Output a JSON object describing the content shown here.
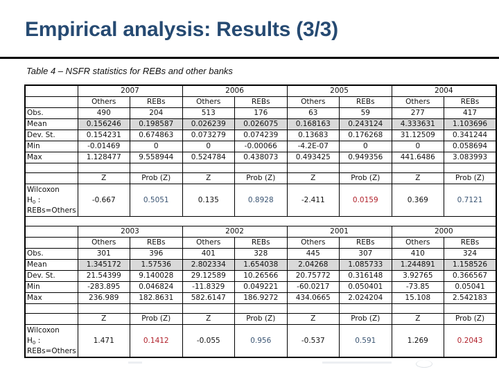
{
  "slide": {
    "title": "Empirical analysis: Results (3/3)",
    "caption": "Table 4 – NSFR statistics for REBs and other banks"
  },
  "table": {
    "group_labels": [
      "Others",
      "REBs"
    ],
    "row_labels": {
      "obs": "Obs.",
      "mean": "Mean",
      "dev": "Dev. St.",
      "min": "Min",
      "max": "Max",
      "z": "Z",
      "prob": "Prob (Z)",
      "wilcoxon_line1": "Wilcoxon",
      "wilcoxon_h": "H",
      "wilcoxon_sub": "0",
      "wilcoxon_colon": " :",
      "wilcoxon_line3": "REBs=Others"
    },
    "panels": [
      {
        "years": [
          {
            "year": "2007",
            "others": {
              "obs": "490",
              "mean": "0.156246",
              "dev": "0.154231",
              "min": "-0.01469",
              "max": "1.128477"
            },
            "rebs": {
              "obs": "204",
              "mean": "0.198587",
              "dev": "0.674863",
              "min": "0",
              "max": "9.558944"
            },
            "z": "-0.667",
            "prob": "0.5051",
            "prob_significant": false
          },
          {
            "year": "2006",
            "others": {
              "obs": "513",
              "mean": "0.026239",
              "dev": "0.073279",
              "min": "0",
              "max": "0.524784"
            },
            "rebs": {
              "obs": "176",
              "mean": "0.026075",
              "dev": "0.074239",
              "min": "-0.00066",
              "max": "0.438073"
            },
            "z": "0.135",
            "prob": "0.8928",
            "prob_significant": false
          },
          {
            "year": "2005",
            "others": {
              "obs": "63",
              "mean": "0.168163",
              "dev": "0.13683",
              "min": "-4.2E-07",
              "max": "0.493425"
            },
            "rebs": {
              "obs": "59",
              "mean": "0.243124",
              "dev": "0.176268",
              "min": "0",
              "max": "0.949356"
            },
            "z": "-2.411",
            "prob": "0.0159",
            "prob_significant": true
          },
          {
            "year": "2004",
            "others": {
              "obs": "277",
              "mean": "4.333631",
              "dev": "31.12509",
              "min": "0",
              "max": "441.6486"
            },
            "rebs": {
              "obs": "417",
              "mean": "1.103696",
              "dev": "0.341244",
              "min": "0.058694",
              "max": "3.083993"
            },
            "z": "0.369",
            "prob": "0.7121",
            "prob_significant": false
          }
        ]
      },
      {
        "years": [
          {
            "year": "2003",
            "others": {
              "obs": "301",
              "mean": "1.345172",
              "dev": "21.54399",
              "min": "-283.895",
              "max": "236.989"
            },
            "rebs": {
              "obs": "396",
              "mean": "1.57536",
              "dev": "9.140028",
              "min": "0.046824",
              "max": "182.8631"
            },
            "z": "1.471",
            "prob": "0.1412",
            "prob_significant": true
          },
          {
            "year": "2002",
            "others": {
              "obs": "401",
              "mean": "2.802334",
              "dev": "29.12589",
              "min": "-11.8329",
              "max": "582.6147"
            },
            "rebs": {
              "obs": "328",
              "mean": "1.654038",
              "dev": "10.26566",
              "min": "0.049221",
              "max": "186.9272"
            },
            "z": "-0.055",
            "prob": "0.956",
            "prob_significant": false
          },
          {
            "year": "2001",
            "others": {
              "obs": "445",
              "mean": "2.04268",
              "dev": "20.75772",
              "min": "-60.0217",
              "max": "434.0665"
            },
            "rebs": {
              "obs": "307",
              "mean": "1.085733",
              "dev": "0.316148",
              "min": "0.050401",
              "max": "2.024204"
            },
            "z": "-0.537",
            "prob": "0.591",
            "prob_significant": false
          },
          {
            "year": "2000",
            "others": {
              "obs": "410",
              "mean": "1.244891",
              "dev": "3.92765",
              "min": "-73.85",
              "max": "15.108"
            },
            "rebs": {
              "obs": "324",
              "mean": "1.158526",
              "dev": "0.366567",
              "min": "0.05041",
              "max": "2.542183"
            },
            "z": "1.269",
            "prob": "0.2043",
            "prob_significant": true
          }
        ]
      }
    ]
  },
  "colors": {
    "title": "#264a72",
    "mean_row_fill": "#d9d9d9",
    "prob_not_significant": "#3b5573",
    "prob_highlight": "#b0202a"
  }
}
